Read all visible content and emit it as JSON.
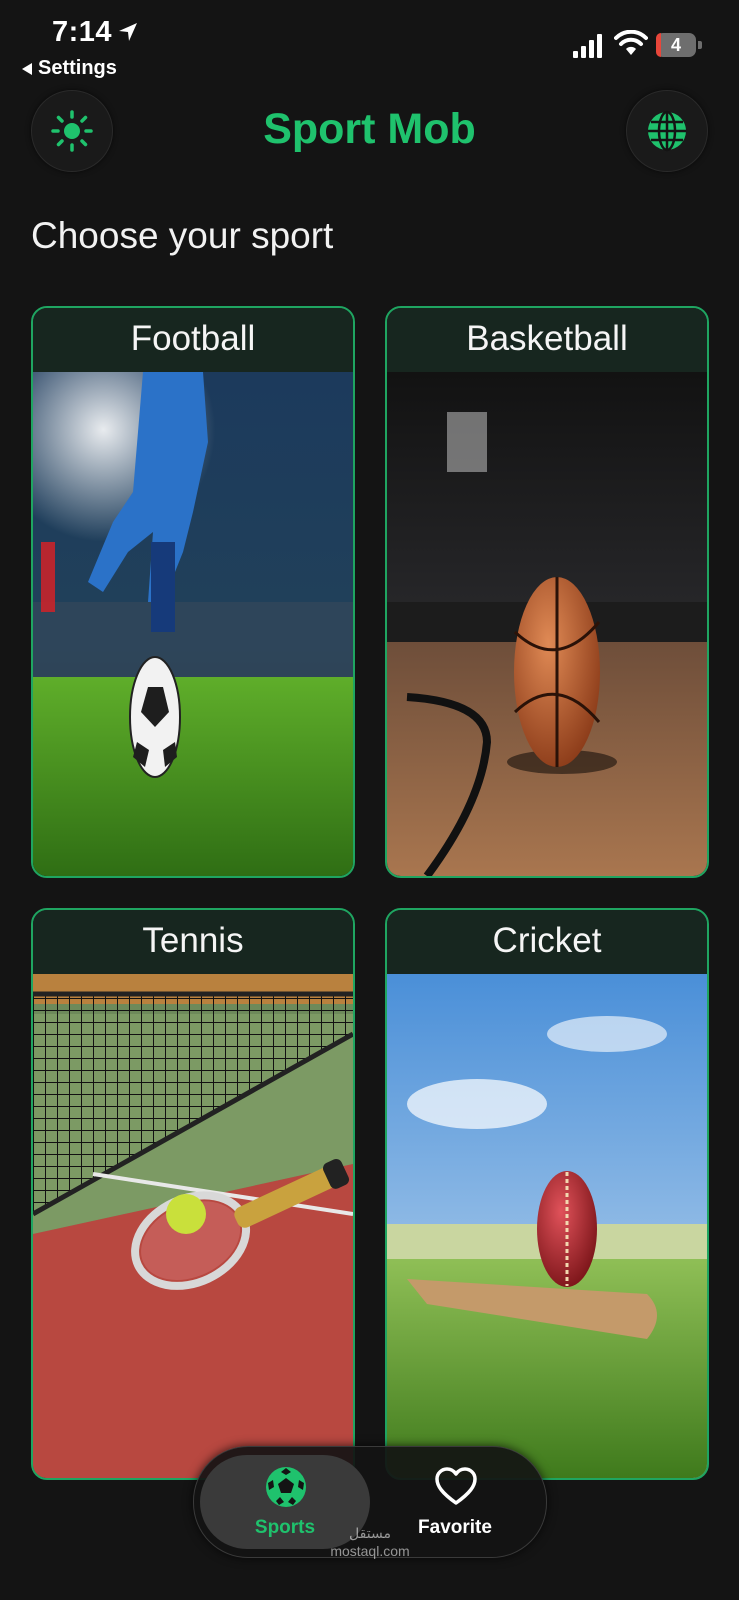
{
  "status_bar": {
    "time": "7:14",
    "back_label": "Settings",
    "battery_level": "4",
    "icons": [
      "location-arrow-icon",
      "cellular-signal-icon",
      "wifi-icon",
      "battery-icon"
    ]
  },
  "header": {
    "title": "Sport Mob",
    "left_icon": "sun-icon",
    "right_icon": "globe-icon"
  },
  "section_title": "Choose your sport",
  "sports": [
    {
      "name": "Football"
    },
    {
      "name": "Basketball"
    },
    {
      "name": "Tennis"
    },
    {
      "name": "Cricket"
    }
  ],
  "tab_bar": {
    "tabs": [
      {
        "label": "Sports",
        "icon": "soccer-ball-icon",
        "active": true
      },
      {
        "label": "Favorite",
        "icon": "heart-icon",
        "active": false
      }
    ]
  },
  "watermark": {
    "line1": "مستقل",
    "line2": "mostaql.com"
  },
  "colors": {
    "accent": "#1fc26d",
    "background": "#141414",
    "card_header": "#17261f",
    "card_border": "#1fa561"
  }
}
